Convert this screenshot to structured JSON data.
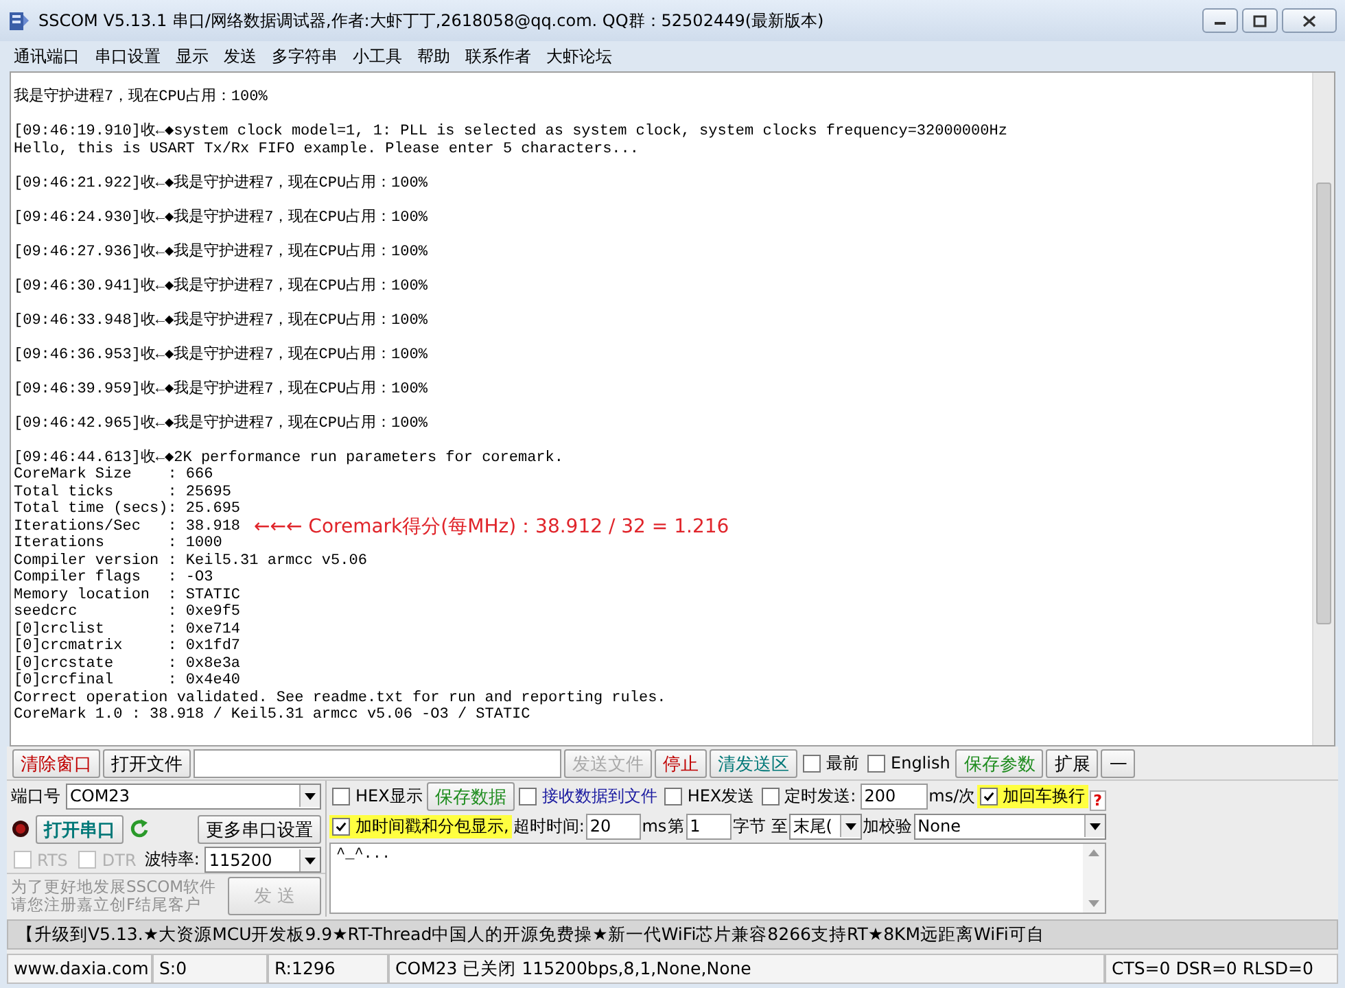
{
  "window": {
    "title": "SSCOM V5.13.1 串口/网络数据调试器,作者:大虾丁丁,2618058@qq.com. QQ群：52502449(最新版本)"
  },
  "menu": [
    "通讯端口",
    "串口设置",
    "显示",
    "发送",
    "多字符串",
    "小工具",
    "帮助",
    "联系作者",
    "大虾论坛"
  ],
  "log": {
    "blocks": [
      {
        "lines": [
          {
            "text": "我是守护进程7，现在CPU占用：100%"
          }
        ]
      },
      {
        "lines": [
          {
            "text": "[09:46:19.910]收←◆system clock model=1, 1: PLL is selected as system clock, system clocks frequency=32000000Hz"
          },
          {
            "text": "Hello, this is USART Tx/Rx FIFO example. Please enter 5 characters..."
          }
        ]
      },
      {
        "lines": [
          {
            "text": "[09:46:21.922]收←◆我是守护进程7，现在CPU占用：100%"
          }
        ]
      },
      {
        "lines": [
          {
            "text": "[09:46:24.930]收←◆我是守护进程7，现在CPU占用：100%"
          }
        ]
      },
      {
        "lines": [
          {
            "text": "[09:46:27.936]收←◆我是守护进程7，现在CPU占用：100%"
          }
        ]
      },
      {
        "lines": [
          {
            "text": "[09:46:30.941]收←◆我是守护进程7，现在CPU占用：100%"
          }
        ]
      },
      {
        "lines": [
          {
            "text": "[09:46:33.948]收←◆我是守护进程7，现在CPU占用：100%"
          }
        ]
      },
      {
        "lines": [
          {
            "text": "[09:46:36.953]收←◆我是守护进程7，现在CPU占用：100%"
          }
        ]
      },
      {
        "lines": [
          {
            "text": "[09:46:39.959]收←◆我是守护进程7，现在CPU占用：100%"
          }
        ]
      },
      {
        "lines": [
          {
            "text": "[09:46:42.965]收←◆我是守护进程7，现在CPU占用：100%"
          }
        ]
      },
      {
        "lines": [
          {
            "text": "[09:46:44.613]收←◆2K performance run parameters for coremark."
          },
          {
            "text": "CoreMark Size    : 666"
          },
          {
            "text": "Total ticks      : 25695"
          },
          {
            "text": "Total time (secs): 25.695"
          },
          {
            "text": "Iterations/Sec   : 38.918",
            "annotation": "←←← Coremark得分(每MHz)：38.912 / 32 = 1.216"
          },
          {
            "text": "Iterations       : 1000"
          },
          {
            "text": "Compiler version : Keil5.31 armcc v5.06"
          },
          {
            "text": "Compiler flags   : -O3"
          },
          {
            "text": "Memory location  : STATIC"
          },
          {
            "text": "seedcrc          : 0xe9f5"
          },
          {
            "text": "[0]crclist       : 0xe714"
          },
          {
            "text": "[0]crcmatrix     : 0x1fd7"
          },
          {
            "text": "[0]crcstate      : 0x8e3a"
          },
          {
            "text": "[0]crcfinal      : 0x4e40"
          },
          {
            "text": "Correct operation validated. See readme.txt for run and reporting rules."
          },
          {
            "text": "CoreMark 1.0 : 38.918 / Keil5.31 armcc v5.06 -O3 / STATIC"
          }
        ]
      }
    ]
  },
  "toolbar": [
    {
      "kind": "button",
      "label": "清除窗口",
      "color": "#c00000",
      "disabled": false
    },
    {
      "kind": "button",
      "label": "打开文件",
      "disabled": false
    },
    {
      "kind": "field"
    },
    {
      "kind": "button",
      "label": "发送文件",
      "disabled": true
    },
    {
      "kind": "button",
      "label": "停止",
      "color": "#c00000",
      "disabled": false
    },
    {
      "kind": "button",
      "label": "清发送区",
      "color": "#007878",
      "disabled": false
    },
    {
      "kind": "checkbox",
      "label": "最前",
      "checked": false,
      "highlighted": false
    },
    {
      "kind": "checkbox",
      "label": "English",
      "checked": false,
      "highlighted": false
    },
    {
      "kind": "button",
      "label": "保存参数",
      "color": "#1e8c1e",
      "disabled": false
    },
    {
      "kind": "button",
      "label": "扩展",
      "disabled": false
    },
    {
      "kind": "button",
      "label": "—",
      "disabled": false
    }
  ],
  "port": {
    "port_label": "端口号",
    "port_value": "COM23",
    "open_button": "打开串口",
    "more_button": "更多串口设置",
    "rts": {
      "label": "RTS",
      "checked": false,
      "disabled": true
    },
    "dtr": {
      "label": "DTR",
      "checked": false,
      "disabled": true
    },
    "baud_label": "波特率:",
    "baud_value": "115200",
    "notice": [
      "为了更好地发展SSCOM软件",
      "请您注册嘉立创F结尾客户"
    ],
    "send_button": {
      "label": "发 送",
      "disabled": true
    }
  },
  "options": [
    [
      {
        "kind": "checkbox",
        "label": "HEX显示",
        "checked": false,
        "highlighted": false
      },
      {
        "kind": "button",
        "label": "保存数据",
        "color": "#1e8c1e",
        "disabled": false
      },
      {
        "kind": "checkbox",
        "label": "接收数据到文件",
        "checked": false,
        "highlighted": false,
        "color": "#1a1aa0"
      },
      {
        "kind": "checkbox",
        "label": "HEX发送",
        "checked": false,
        "highlighted": false
      },
      {
        "kind": "checkbox",
        "label": "定时发送:",
        "checked": false,
        "highlighted": false
      },
      {
        "kind": "field",
        "value": "200"
      },
      {
        "kind": "text",
        "label": "ms/次"
      },
      {
        "kind": "checkbox",
        "label": "加回车换行",
        "checked": true,
        "highlighted": true
      },
      {
        "kind": "help",
        "label": "?"
      }
    ],
    [
      {
        "kind": "checkbox",
        "label": "加时间戳和分包显示,",
        "checked": true,
        "highlighted": true
      },
      {
        "kind": "text",
        "label": "超时时间:"
      },
      {
        "kind": "field",
        "value": "20"
      },
      {
        "kind": "text",
        "label": "ms"
      },
      {
        "kind": "text",
        "label": "第"
      },
      {
        "kind": "field",
        "value": "1"
      },
      {
        "kind": "text",
        "label": "字节 至"
      },
      {
        "kind": "combo",
        "value": "末尾("
      },
      {
        "kind": "text",
        "label": "加校验"
      },
      {
        "kind": "combo",
        "value": "None"
      }
    ]
  ],
  "send_text": "^_^...",
  "ticker": "【升级到V5.13.★大资源MCU开发板9.9★RT-Thread中国人的开源免费操★新一代WiFi芯片兼容8266支持RT★8KM远距离WiFi可自",
  "status_bar": [
    "www.daxia.com",
    "S:0",
    "R:1296",
    "COM23 已关闭  115200bps,8,1,None,None",
    "CTS=0 DSR=0 RLSD=0"
  ]
}
